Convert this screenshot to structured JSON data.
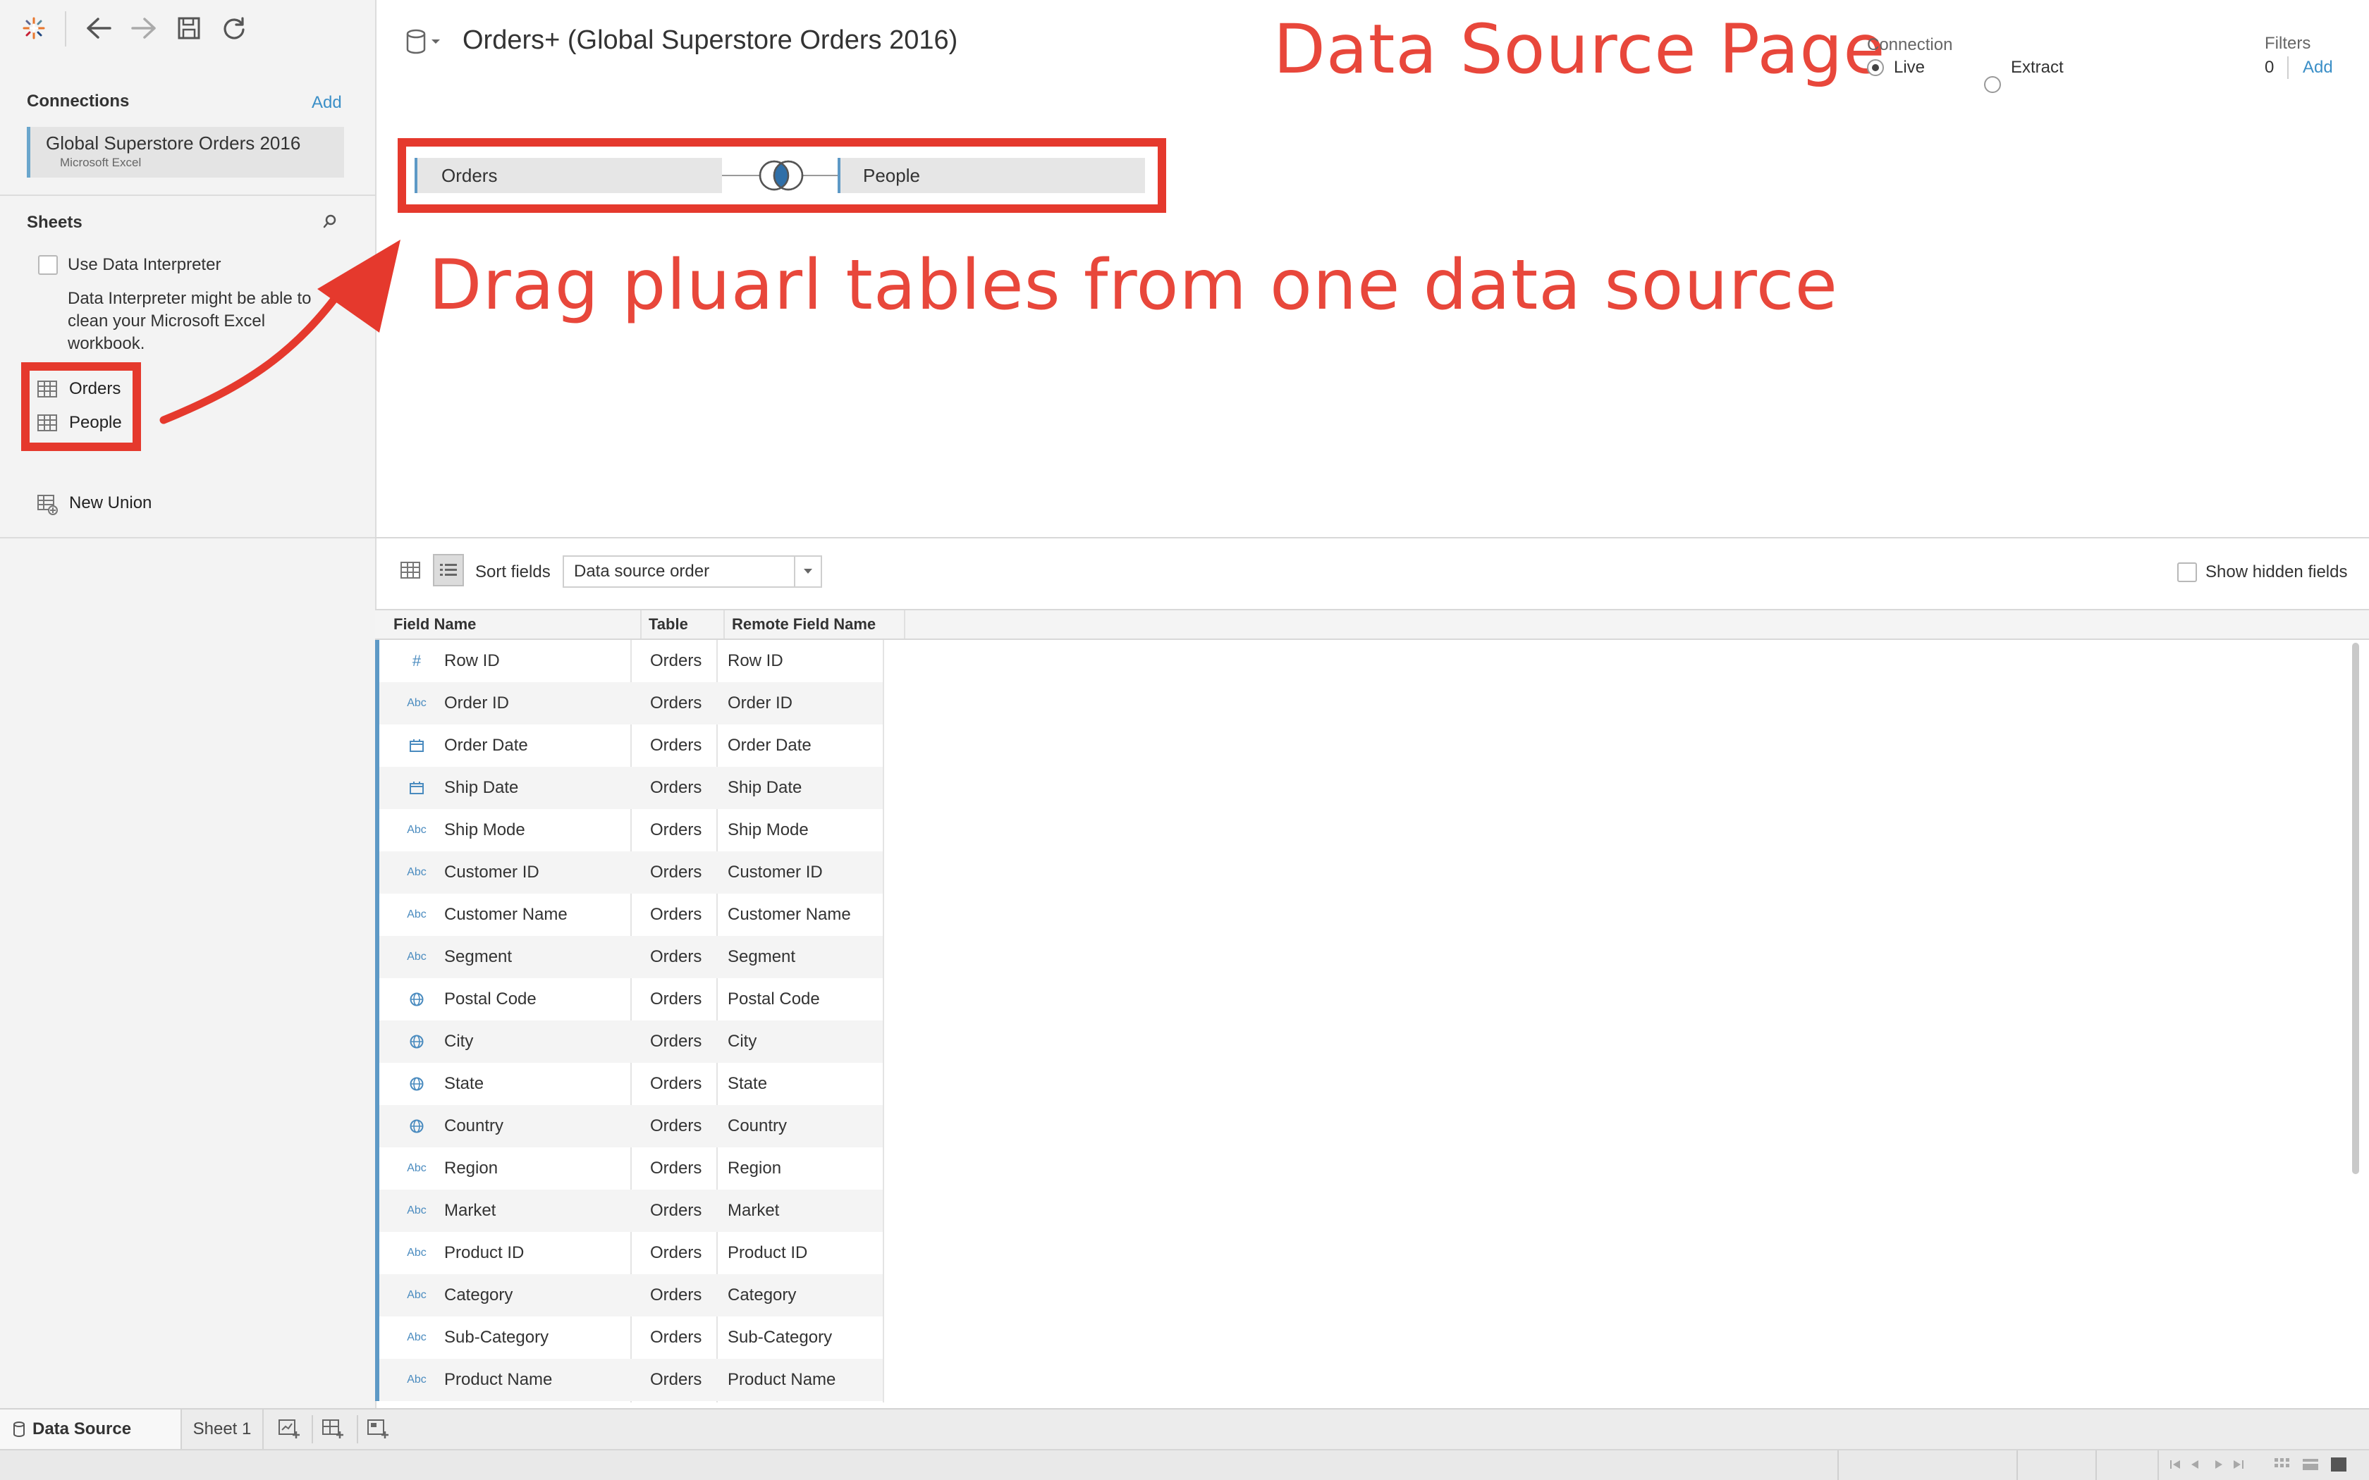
{
  "header": {
    "datasource_title": "Orders+ (Global Superstore Orders 2016)",
    "annotation_title": "Data Source Page",
    "annotation_drag": "Drag pluarl tables from one data source",
    "connection_label": "Connection",
    "live_label": "Live",
    "extract_label": "Extract",
    "filters_label": "Filters",
    "filters_count": "0",
    "filters_add": "Add"
  },
  "sidebar": {
    "connections_title": "Connections",
    "connections_add": "Add",
    "connection_name": "Global Superstore Orders 2016",
    "connection_type": "Microsoft Excel",
    "sheets_title": "Sheets",
    "use_interpreter": "Use Data Interpreter",
    "interpreter_note_1": "Data Interpreter might be able to",
    "interpreter_note_2": "clean your Microsoft Excel",
    "interpreter_note_3": "workbook.",
    "sheets": [
      "Orders",
      "People"
    ],
    "new_union": "New Union"
  },
  "join": {
    "left_table": "Orders",
    "right_table": "People",
    "join_type": "inner"
  },
  "grid": {
    "sort_label": "Sort fields",
    "sort_value": "Data source order",
    "show_hidden": "Show hidden fields",
    "columns": [
      "Field Name",
      "Table",
      "Remote Field Name"
    ],
    "rows": [
      {
        "type": "#",
        "field": "Row ID",
        "table": "Orders",
        "remote": "Row ID"
      },
      {
        "type": "Abc",
        "field": "Order ID",
        "table": "Orders",
        "remote": "Order ID"
      },
      {
        "type": "date",
        "field": "Order Date",
        "table": "Orders",
        "remote": "Order Date"
      },
      {
        "type": "date",
        "field": "Ship Date",
        "table": "Orders",
        "remote": "Ship Date"
      },
      {
        "type": "Abc",
        "field": "Ship Mode",
        "table": "Orders",
        "remote": "Ship Mode"
      },
      {
        "type": "Abc",
        "field": "Customer ID",
        "table": "Orders",
        "remote": "Customer ID"
      },
      {
        "type": "Abc",
        "field": "Customer Name",
        "table": "Orders",
        "remote": "Customer Name"
      },
      {
        "type": "Abc",
        "field": "Segment",
        "table": "Orders",
        "remote": "Segment"
      },
      {
        "type": "geo",
        "field": "Postal Code",
        "table": "Orders",
        "remote": "Postal Code"
      },
      {
        "type": "geo",
        "field": "City",
        "table": "Orders",
        "remote": "City"
      },
      {
        "type": "geo",
        "field": "State",
        "table": "Orders",
        "remote": "State"
      },
      {
        "type": "geo",
        "field": "Country",
        "table": "Orders",
        "remote": "Country"
      },
      {
        "type": "Abc",
        "field": "Region",
        "table": "Orders",
        "remote": "Region"
      },
      {
        "type": "Abc",
        "field": "Market",
        "table": "Orders",
        "remote": "Market"
      },
      {
        "type": "Abc",
        "field": "Product ID",
        "table": "Orders",
        "remote": "Product ID"
      },
      {
        "type": "Abc",
        "field": "Category",
        "table": "Orders",
        "remote": "Category"
      },
      {
        "type": "Abc",
        "field": "Sub-Category",
        "table": "Orders",
        "remote": "Sub-Category"
      },
      {
        "type": "Abc",
        "field": "Product Name",
        "table": "Orders",
        "remote": "Product Name"
      }
    ]
  },
  "tabs": {
    "data_source": "Data Source",
    "sheet1": "Sheet 1"
  },
  "colors": {
    "annotation_red": "#e8473b",
    "accent_blue": "#3b8fc7",
    "row_marker_blue": "#5d99c6"
  }
}
